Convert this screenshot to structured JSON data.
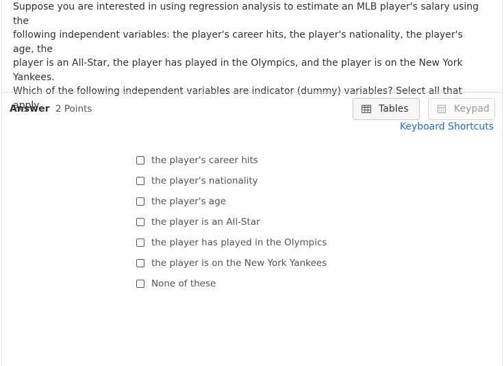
{
  "question": {
    "lines": [
      "Suppose you are interested in using regression analysis to estimate an MLB player's salary using the",
      "following independent variables: the player's career hits, the player's nationality, the player's age, the",
      "player is an All-Star, the player has played in the Olympics, and the player is on the New York Yankees.",
      "Which of the following independent variables are indicator (dummy) variables? Select all that apply."
    ]
  },
  "answer": {
    "label": "Answer",
    "points": "2 Points"
  },
  "toolbar": {
    "tables_label": "Tables",
    "keypad_label": "Keypad",
    "shortcuts_label": "Keyboard Shortcuts",
    "tables_icon": "table-icon",
    "keypad_icon": "calculator-icon"
  },
  "options": [
    {
      "label": "the player's career hits",
      "checked": false
    },
    {
      "label": "the player's nationality",
      "checked": false
    },
    {
      "label": "the player's age",
      "checked": false
    },
    {
      "label": "the player is an All-Star",
      "checked": false
    },
    {
      "label": "the player has played in the Olympics",
      "checked": false
    },
    {
      "label": "the player is on the New York Yankees",
      "checked": false
    },
    {
      "label": "None of these",
      "checked": false
    }
  ],
  "colors": {
    "link": "#2a6ebb",
    "text": "#333333",
    "muted": "#555555"
  }
}
